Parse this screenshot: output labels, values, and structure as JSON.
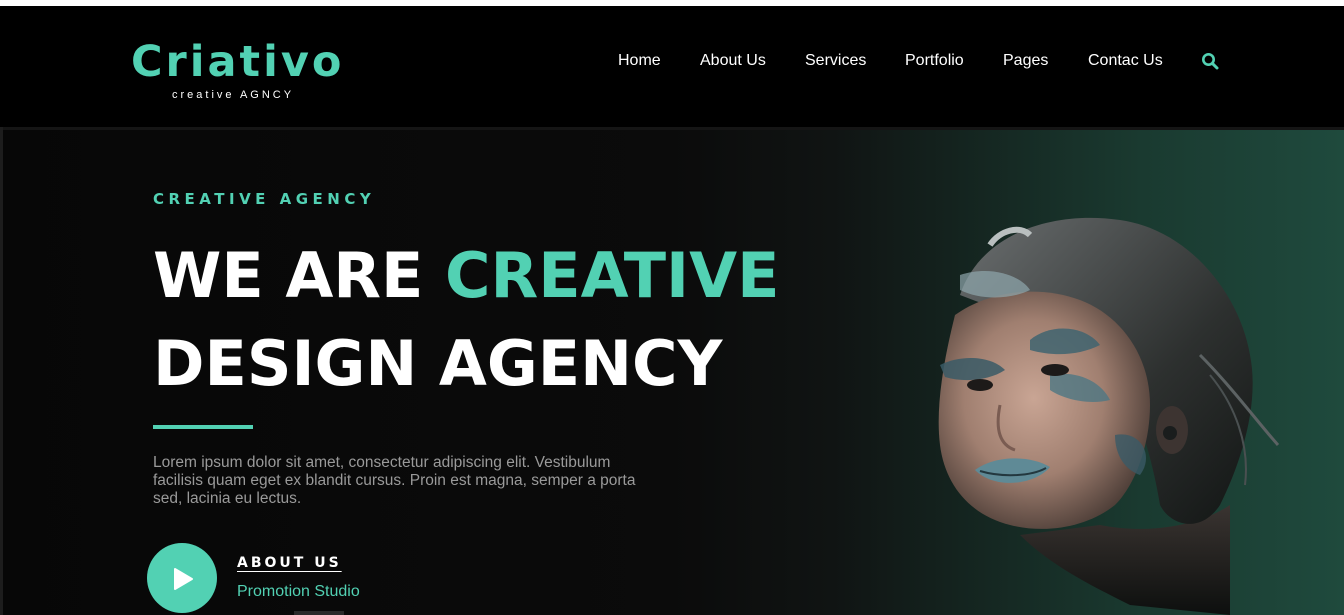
{
  "colors": {
    "accent": "#52d1b3",
    "background": "#000000",
    "text": "#ffffff",
    "muted": "#9a9a9a"
  },
  "brand": {
    "name": "Criativo",
    "tagline": "creative  AGNCY"
  },
  "nav": {
    "items": [
      {
        "label": "Home"
      },
      {
        "label": "About Us"
      },
      {
        "label": "Services"
      },
      {
        "label": "Portfolio"
      },
      {
        "label": "Pages"
      },
      {
        "label": "Contac Us"
      }
    ],
    "search_icon": "search-icon"
  },
  "hero": {
    "kicker": "CREATIVE  AGENCY",
    "headline_part1": "WE ARE ",
    "headline_accent": "CREATIVE",
    "headline_line2": "DESIGN AGENCY",
    "body": "Lorem ipsum dolor sit amet, consectetur adipiscing elit. Vestibulum facilisis quam eget ex blandit cursus. Proin est magna, semper a porta sed, lacinia eu lectus.",
    "cta_label": "ABOUT US",
    "cta_sub": "Promotion Studio",
    "play_icon": "play-icon",
    "image": "portrait-with-paint-makeup"
  }
}
